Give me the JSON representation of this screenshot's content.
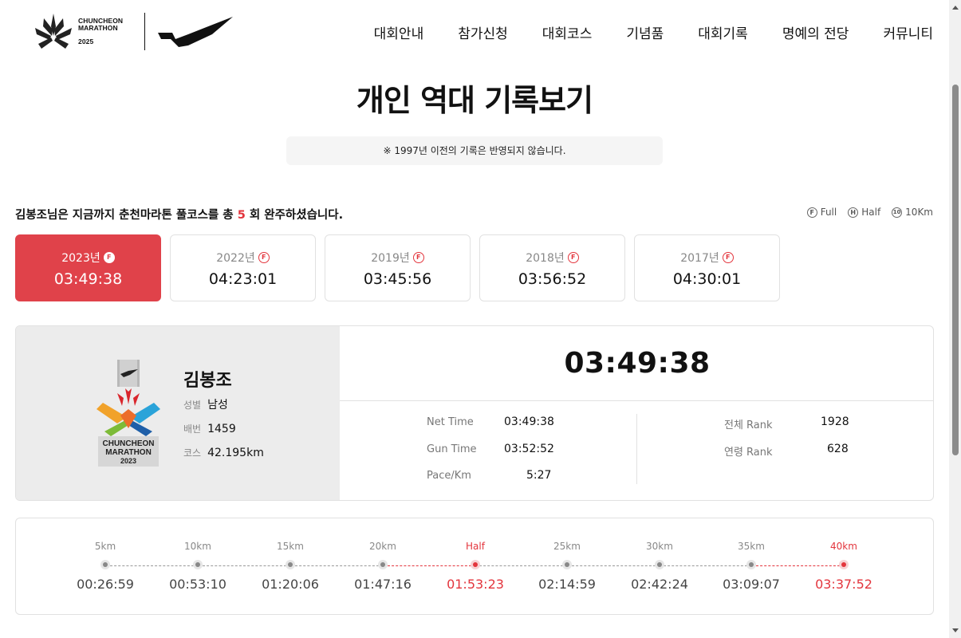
{
  "logo": {
    "line1": "CHUNCHEON",
    "line2": "MARATHON",
    "year": "2025"
  },
  "nav": [
    "대회안내",
    "참가신청",
    "대회코스",
    "기념품",
    "대회기록",
    "명예의 전당",
    "커뮤니티"
  ],
  "title": "개인 역대 기록보기",
  "notice": "※ 1997년 이전의 기록은 반영되지 않습니다.",
  "summary": {
    "prefix": "김봉조님은 지금까지 춘천마라톤 풀코스를 총 ",
    "count": "5",
    "suffix": " 회 완주하셨습니다."
  },
  "legend": [
    {
      "icon": "F",
      "label": "Full"
    },
    {
      "icon": "H",
      "label": "Half"
    },
    {
      "icon": "10",
      "label": "10Km"
    }
  ],
  "years": [
    {
      "year": "2023년",
      "badge": "F",
      "time": "03:49:38",
      "active": true
    },
    {
      "year": "2022년",
      "badge": "F",
      "time": "04:23:01",
      "active": false
    },
    {
      "year": "2019년",
      "badge": "F",
      "time": "03:45:56",
      "active": false
    },
    {
      "year": "2018년",
      "badge": "F",
      "time": "03:56:52",
      "active": false
    },
    {
      "year": "2017년",
      "badge": "F",
      "time": "04:30:01",
      "active": false
    }
  ],
  "runner": {
    "name": "김봉조",
    "gender_label": "성별",
    "gender": "남성",
    "bib_label": "배번",
    "bib": "1459",
    "course_label": "코스",
    "course": "42.195km",
    "medal_line1": "CHUNCHEON",
    "medal_line2": "MARATHON",
    "medal_year": "2023"
  },
  "result": {
    "time": "03:49:38",
    "net_label": "Net Time",
    "net": "03:49:38",
    "gun_label": "Gun Time",
    "gun": "03:52:52",
    "pace_label": "Pace/Km",
    "pace": "5:27",
    "overall_label": "전체 Rank",
    "overall": "1928",
    "age_label": "연령 Rank",
    "age": "628"
  },
  "splits": [
    {
      "km": "5km",
      "time": "00:26:59",
      "red": false
    },
    {
      "km": "10km",
      "time": "00:53:10",
      "red": false
    },
    {
      "km": "15km",
      "time": "01:20:06",
      "red": false
    },
    {
      "km": "20km",
      "time": "01:47:16",
      "red": false
    },
    {
      "km": "Half",
      "time": "01:53:23",
      "red": true
    },
    {
      "km": "25km",
      "time": "02:14:59",
      "red": false
    },
    {
      "km": "30km",
      "time": "02:42:24",
      "red": false
    },
    {
      "km": "35km",
      "time": "03:09:07",
      "red": false
    },
    {
      "km": "40km",
      "time": "03:37:52",
      "red": true
    }
  ],
  "colors": {
    "accent": "#e0424a",
    "red_text": "#e3353d"
  }
}
